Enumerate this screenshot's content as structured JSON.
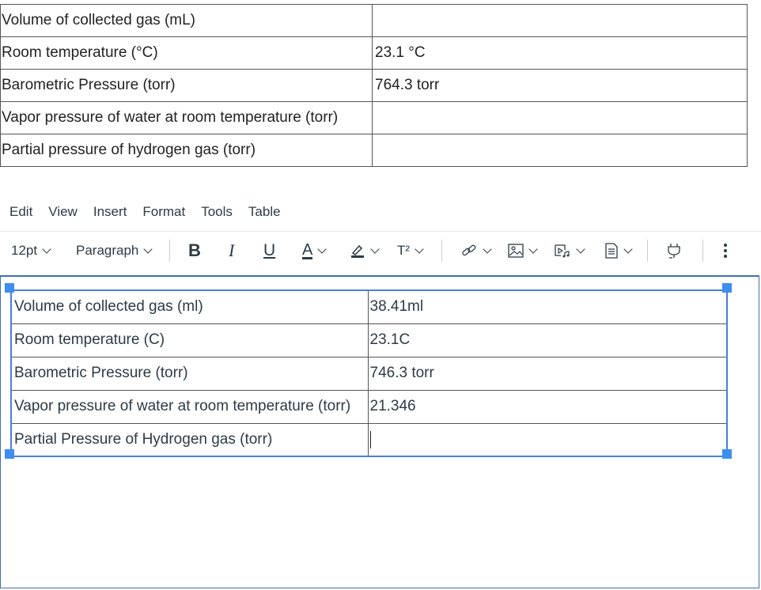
{
  "reference_table": {
    "rows": [
      {
        "label": "Volume of collected gas (mL)",
        "value": ""
      },
      {
        "label": "Room temperature (°C)",
        "value": "23.1 °C"
      },
      {
        "label": "Barometric Pressure (torr)",
        "value": "764.3 torr"
      },
      {
        "label": "Vapor pressure of water at room temperature (torr)",
        "value": ""
      },
      {
        "label": "Partial pressure of hydrogen gas (torr)",
        "value": ""
      }
    ]
  },
  "menubar": {
    "items": [
      "Edit",
      "View",
      "Insert",
      "Format",
      "Tools",
      "Table"
    ]
  },
  "toolbar": {
    "font_size": "12pt",
    "block_format": "Paragraph",
    "bold": "B",
    "italic": "I",
    "underline": "U",
    "text_color": "A",
    "superscript": "T²",
    "icons": [
      "bold-icon",
      "italic-icon",
      "underline-icon",
      "text-color-icon",
      "highlight-icon",
      "superscript-icon",
      "link-icon",
      "image-icon",
      "media-icon",
      "document-icon",
      "plugin-icon",
      "more-icon"
    ]
  },
  "editor_table": {
    "rows": [
      {
        "label": "Volume of collected gas (ml)",
        "value": "38.41ml"
      },
      {
        "label": "Room temperature (C)",
        "value": "23.1C"
      },
      {
        "label": "Barometric Pressure (torr)",
        "value": "746.3 torr"
      },
      {
        "label": "Vapor pressure of water at room temperature (torr)",
        "value": "21.346"
      },
      {
        "label": "Partial Pressure of Hydrogen gas (torr)",
        "value": ""
      }
    ]
  },
  "colors": {
    "selection_handle": "#3d8ef0",
    "editor_border": "#3c6fb4",
    "text": "#2d3b45"
  }
}
